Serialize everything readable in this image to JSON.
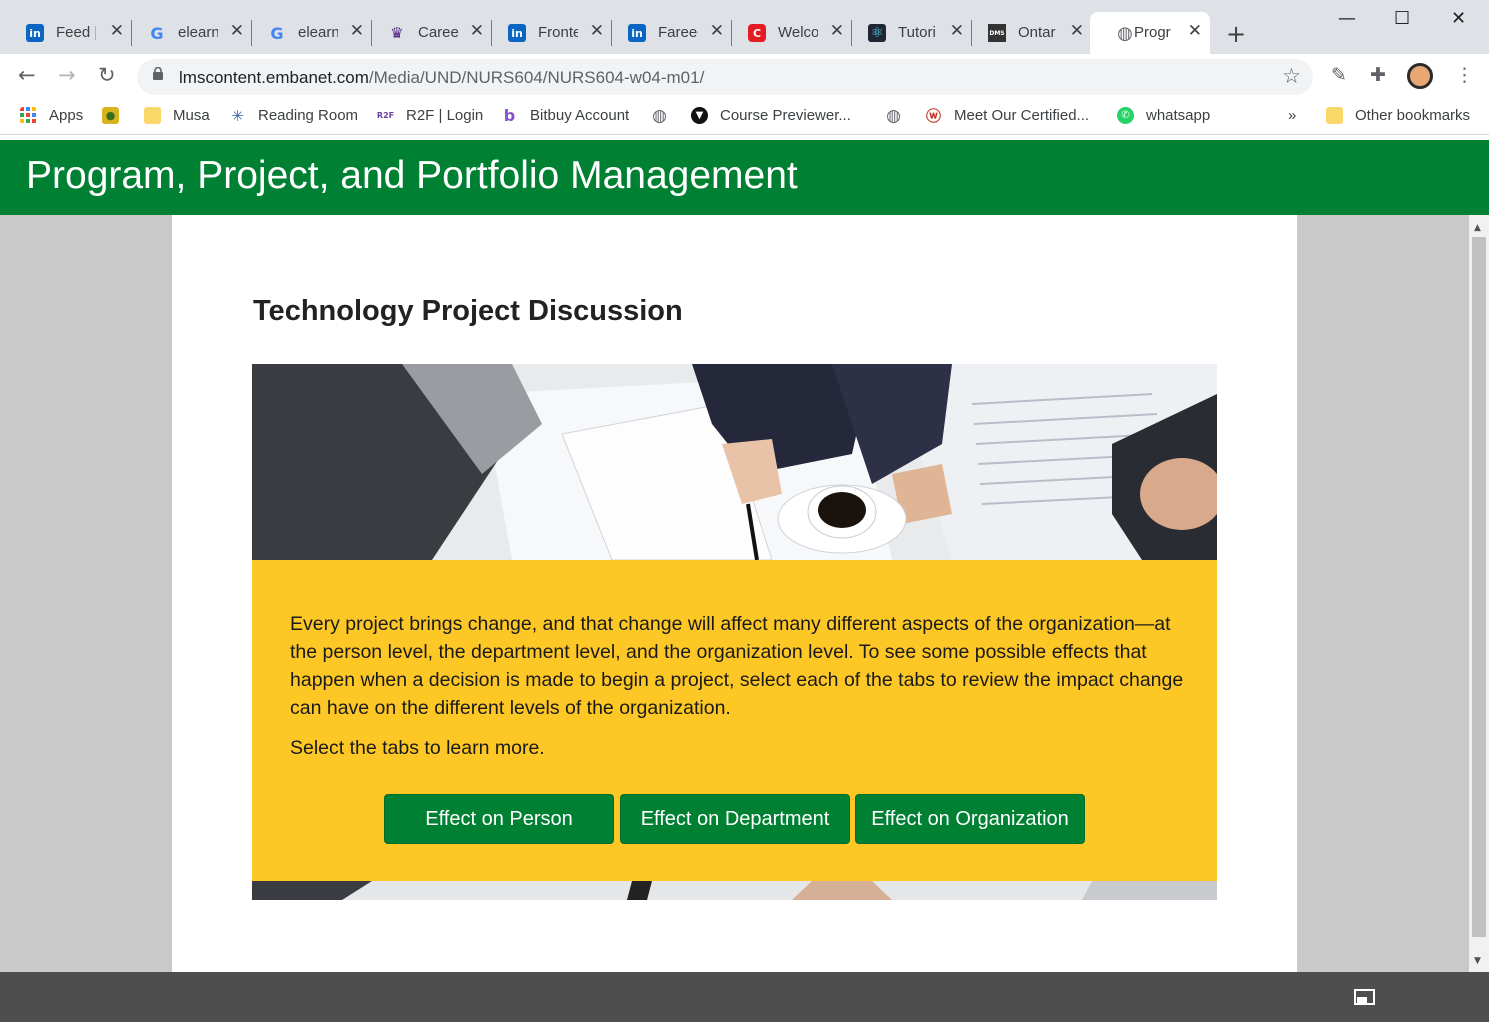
{
  "browser": {
    "tabs": [
      {
        "title": "Feed |",
        "icon": "linkedin-icon",
        "icon_text": "in",
        "icon_color": "#0a66c2"
      },
      {
        "title": "elearn",
        "icon": "google-icon",
        "icon_text": "G",
        "icon_color": "#4285f4"
      },
      {
        "title": "elearn",
        "icon": "google-icon",
        "icon_text": "G",
        "icon_color": "#4285f4"
      },
      {
        "title": "Career",
        "icon": "western-shield-icon",
        "icon_text": "♛",
        "icon_color": "#4f2683"
      },
      {
        "title": "Fronte",
        "icon": "linkedin-icon",
        "icon_text": "in",
        "icon_color": "#0a66c2"
      },
      {
        "title": "Fareed",
        "icon": "linkedin-icon",
        "icon_text": "in",
        "icon_color": "#0a66c2"
      },
      {
        "title": "Welco",
        "icon": "c-logo-icon",
        "icon_text": "C",
        "icon_color": "#e31b23"
      },
      {
        "title": "Tutori",
        "icon": "react-icon",
        "icon_text": "⚛",
        "icon_color": "#1e2733"
      },
      {
        "title": "Ontar",
        "icon": "dms-icon",
        "icon_text": "DMS",
        "icon_color": "#333333"
      },
      {
        "title": "Progr",
        "icon": "globe-icon",
        "icon_text": "◍",
        "icon_color": "#5f6368",
        "active": true
      }
    ],
    "new_tab_label": "+",
    "window_controls": {
      "minimize": "—",
      "maximize": "☐",
      "close": "✕"
    },
    "url": {
      "host": "lmscontent.embanet.com",
      "path": "/Media/UND/NURS604/NURS604-w04-m01/"
    },
    "bookmarks": [
      {
        "label": "Apps",
        "icon": "apps-grid-icon"
      },
      {
        "label": "",
        "icon": "turtle-icon"
      },
      {
        "label": "Musa",
        "icon": "folder-icon"
      },
      {
        "label": "Reading Room",
        "icon": "reading-room-icon"
      },
      {
        "label": "R2F | Login",
        "icon": "r2f-icon"
      },
      {
        "label": "Bitbuy Account",
        "icon": "bitbuy-icon"
      },
      {
        "label": "",
        "icon": "globe-icon"
      },
      {
        "label": "Course Previewer...",
        "icon": "course-previewer-icon"
      },
      {
        "label": "",
        "icon": "globe-icon"
      },
      {
        "label": "Meet Our Certified...",
        "icon": "meet-icon"
      },
      {
        "label": "whatsapp",
        "icon": "whatsapp-icon"
      }
    ],
    "bookmarks_overflow": "»",
    "other_bookmarks": "Other bookmarks"
  },
  "page": {
    "header_title": "Program, Project, and Portfolio Management",
    "heading": "Technology Project Discussion",
    "intro": "Every project brings change, and that change will affect many different aspects of the organization—at the person level, the department level, and the organization level. To see some possible effects that happen when a decision is made to begin a project, select each of the tabs to review the impact change can have on the different levels of the organization.",
    "instruction": "Select the tabs to learn more.",
    "tabs": [
      {
        "label": "Effect on Person"
      },
      {
        "label": "Effect on Department"
      },
      {
        "label": "Effect on Organization"
      }
    ]
  },
  "colors": {
    "brand_green": "#008033",
    "panel_yellow": "#fdc826"
  }
}
